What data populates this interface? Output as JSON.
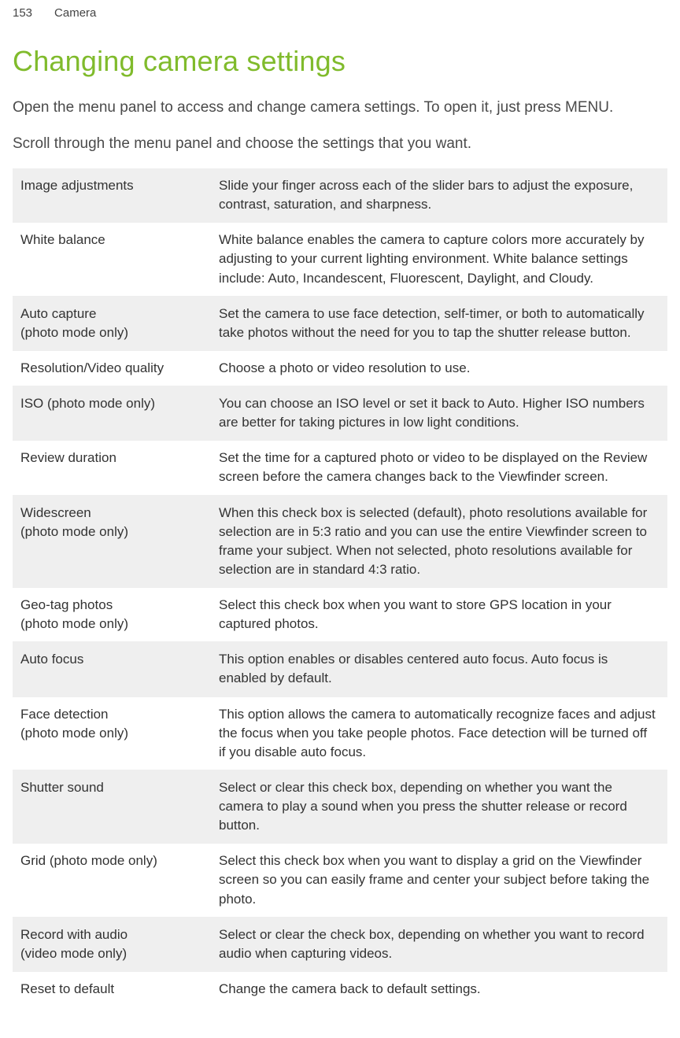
{
  "header": {
    "page_number": "153",
    "section": "Camera"
  },
  "title": "Changing camera settings",
  "intro": [
    "Open the menu panel to access and change camera settings. To open it, just press MENU.",
    "Scroll through the menu panel and choose the settings that you want."
  ],
  "rows": [
    {
      "label": "Image adjustments",
      "sublabel": "",
      "desc": "Slide your finger across each of the slider bars to adjust the exposure, contrast, saturation, and sharpness."
    },
    {
      "label": "White balance",
      "sublabel": "",
      "desc": "White balance enables the camera to capture colors more accurately by adjusting to your current lighting environment. White balance settings include: Auto, Incandescent, Fluorescent, Daylight, and Cloudy."
    },
    {
      "label": "Auto capture",
      "sublabel": "(photo mode only)",
      "desc": "Set the camera to use face detection, self-timer, or both to automatically take photos without the need for you to tap the shutter release button."
    },
    {
      "label": "Resolution/Video quality",
      "sublabel": "",
      "desc": "Choose a photo or video resolution to use."
    },
    {
      "label": "ISO (photo mode only)",
      "sublabel": "",
      "desc": "You can choose an ISO level or set it back to Auto. Higher ISO numbers are better for taking pictures in low light conditions."
    },
    {
      "label": "Review duration",
      "sublabel": "",
      "desc": "Set the time for a captured photo or video to be displayed on the Review screen before the camera changes back to the Viewfinder screen."
    },
    {
      "label": "Widescreen",
      "sublabel": "(photo mode only)",
      "desc": "When this check box is selected (default), photo resolutions available for selection are in 5:3 ratio and you can use the entire Viewfinder screen to frame your subject. When not selected, photo resolutions available for selection are in standard 4:3 ratio."
    },
    {
      "label": "Geo-tag photos",
      "sublabel": "(photo mode only)",
      "desc": "Select this check box when you want to store GPS location in your captured photos."
    },
    {
      "label": "Auto focus",
      "sublabel": "",
      "desc": "This option enables or disables centered auto focus. Auto focus is enabled by default."
    },
    {
      "label": "Face detection",
      "sublabel": "(photo mode only)",
      "desc": "This option allows the camera to automatically recognize faces and adjust the focus when you take people photos. Face detection will be turned off if you disable auto focus."
    },
    {
      "label": "Shutter sound",
      "sublabel": "",
      "desc": "Select or clear this check box, depending on whether you want the camera to play a sound when you press the shutter release or record button."
    },
    {
      "label": "Grid (photo mode only)",
      "sublabel": "",
      "desc": "Select this check box when you want to display a grid on the Viewfinder screen so you can easily frame and center your subject before taking the photo."
    },
    {
      "label": "Record with audio",
      "sublabel": "(video mode only)",
      "desc": "Select or clear the check box, depending on whether you want to record audio when capturing videos."
    },
    {
      "label": "Reset to default",
      "sublabel": "",
      "desc": "Change the camera back to default settings."
    }
  ]
}
